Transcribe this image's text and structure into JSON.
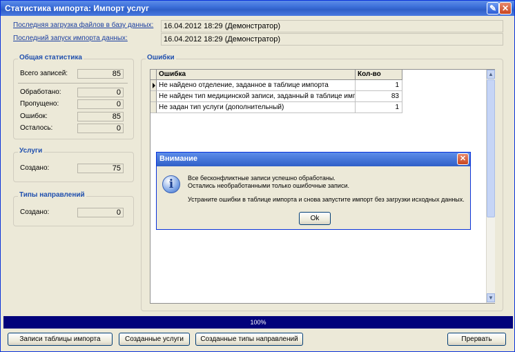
{
  "window": {
    "title": "Статистика импорта: Импорт услуг",
    "tool_icon": "wrench-icon",
    "close_icon": "close-icon"
  },
  "info_rows": [
    {
      "label": "Последняя загрузка файлов в базу данных:",
      "value": "16.04.2012 18:29 (Демонстратор)"
    },
    {
      "label": "Последний запуск импорта данных:",
      "value": "16.04.2012 18:29 (Демонстратор)"
    }
  ],
  "general_stats": {
    "title": "Общая статистика",
    "total_label": "Всего записей:",
    "total_value": "85",
    "processed_label": "Обработано:",
    "processed_value": "0",
    "skipped_label": "Пропущено:",
    "skipped_value": "0",
    "errors_label": "Ошибок:",
    "errors_value": "85",
    "remaining_label": "Осталось:",
    "remaining_value": "0"
  },
  "services": {
    "title": "Услуги",
    "created_label": "Создано:",
    "created_value": "75"
  },
  "referral_types": {
    "title": "Типы направлений",
    "created_label": "Создано:",
    "created_value": "0"
  },
  "errors": {
    "title": "Ошибки",
    "columns": [
      "Ошибка",
      "Кол-во"
    ],
    "rows": [
      {
        "error": "Не найдено отделение, заданное в таблице импорта",
        "count": "1"
      },
      {
        "error": "Не найден тип медицинской записи, заданный в таблице импо",
        "count": "83"
      },
      {
        "error": "Не задан тип услуги (дополнительный)",
        "count": "1"
      }
    ]
  },
  "dialog": {
    "title": "Внимание",
    "icon": "info-icon",
    "line1": "Все бесконфликтные записи успешно обработаны.",
    "line2": "Остались необработанными только ошибочные записи.",
    "line3": "Устраните ошибки в таблице импорта и снова запустите импорт без загрузки исходных данных.",
    "ok_label": "Ok"
  },
  "progress": {
    "text": "100%",
    "value": 1.0
  },
  "buttons": {
    "import_records": "Записи таблицы импорта",
    "created_services": "Созданные услуги",
    "created_referral_types": "Созданные типы направлений",
    "abort": "Прервать"
  }
}
